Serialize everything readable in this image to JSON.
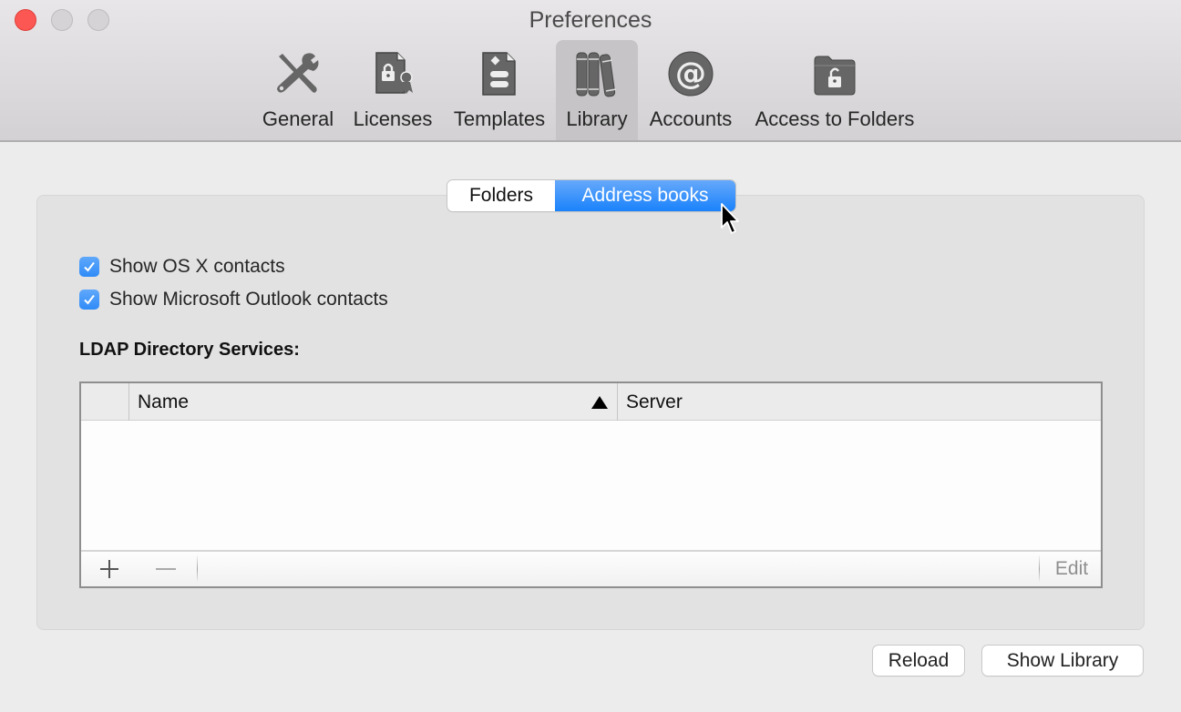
{
  "window": {
    "title": "Preferences",
    "controls": {
      "close": "close-button",
      "minimize": "minimize-button",
      "zoom": "zoom-button"
    }
  },
  "toolbar": {
    "selected": "Library",
    "items": [
      {
        "label": "General",
        "icon": "tools-icon"
      },
      {
        "label": "Licenses",
        "icon": "license-certificate-icon"
      },
      {
        "label": "Templates",
        "icon": "template-document-icon"
      },
      {
        "label": "Library",
        "icon": "books-icon"
      },
      {
        "label": "Accounts",
        "icon": "at-sign-icon"
      },
      {
        "label": "Access to Folders",
        "icon": "locked-folder-icon"
      }
    ]
  },
  "segmented": {
    "options": [
      "Folders",
      "Address books"
    ],
    "selected": "Address books",
    "accent": "#1a82fb"
  },
  "checkboxes": [
    {
      "label": "Show OS X contacts",
      "checked": true
    },
    {
      "label": "Show Microsoft Outlook contacts",
      "checked": true
    }
  ],
  "ldap": {
    "title": "LDAP Directory Services:",
    "columns": [
      "Name",
      "Server"
    ],
    "sort_column": "Name",
    "sort_direction": "ascending",
    "rows": [],
    "footer": {
      "add": "+",
      "remove": "−",
      "edit": "Edit"
    }
  },
  "buttons": {
    "reload": "Reload",
    "show_library": "Show Library"
  }
}
